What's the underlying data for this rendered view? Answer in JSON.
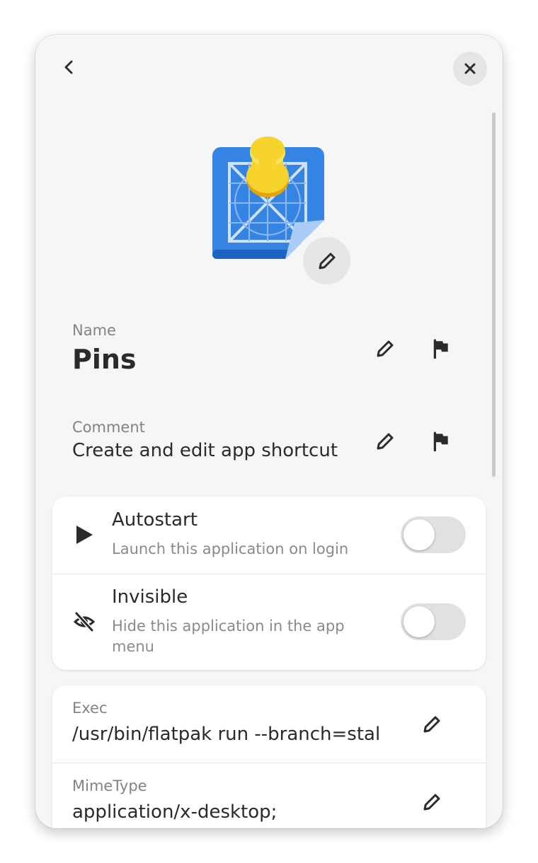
{
  "header": {
    "back_icon": "chevron-left-icon",
    "close_icon": "close-icon"
  },
  "app_icon": {
    "name": "pin-on-blueprint-icon",
    "edit_icon": "pencil-icon"
  },
  "name_field": {
    "label": "Name",
    "value": "Pins",
    "edit_icon": "pencil-icon",
    "flag_icon": "flag-icon"
  },
  "comment_field": {
    "label": "Comment",
    "value": "Create and edit app shortcut",
    "edit_icon": "pencil-icon",
    "flag_icon": "flag-icon"
  },
  "options": [
    {
      "icon": "play-icon",
      "title": "Autostart",
      "subtitle": "Launch this application on login",
      "enabled": false
    },
    {
      "icon": "eye-slash-icon",
      "title": "Invisible",
      "subtitle": "Hide this application in the app menu",
      "enabled": false
    }
  ],
  "properties": [
    {
      "label": "Exec",
      "value": "/usr/bin/flatpak run --branch=stal"
    },
    {
      "label": "MimeType",
      "value": "application/x-desktop;"
    }
  ],
  "colors": {
    "window_bg": "#f6f6f6",
    "card_bg": "#ffffff",
    "icon_blue": "#3584e4",
    "pin_yellow": "#f6d32d",
    "switch_off": "#e1e1e1"
  }
}
